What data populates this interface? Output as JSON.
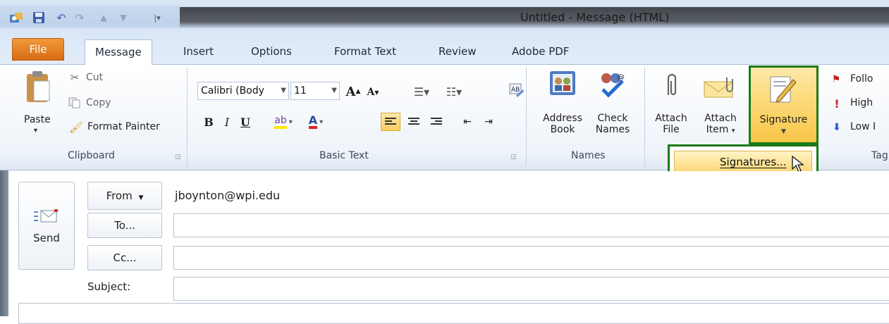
{
  "window": {
    "title": "Untitled  -  Message (HTML)"
  },
  "quick_access": [
    {
      "name": "outlook-app-icon"
    },
    {
      "name": "save-icon"
    },
    {
      "name": "undo-icon"
    },
    {
      "name": "redo-icon"
    },
    {
      "name": "up-arrow-icon"
    },
    {
      "name": "down-arrow-icon"
    },
    {
      "name": "customize-toolbar-icon"
    }
  ],
  "tabs": [
    {
      "label": "File"
    },
    {
      "label": "Message"
    },
    {
      "label": "Insert"
    },
    {
      "label": "Options"
    },
    {
      "label": "Format Text"
    },
    {
      "label": "Review"
    },
    {
      "label": "Adobe PDF"
    }
  ],
  "clipboard": {
    "label": "Clipboard",
    "paste": "Paste",
    "cut": "Cut",
    "copy": "Copy",
    "format_painter": "Format Painter"
  },
  "basic_text": {
    "label": "Basic Text",
    "font_name": "Calibri (Body",
    "font_size": "11",
    "bold": "B",
    "italic": "I",
    "underline": "U",
    "font_color": "A"
  },
  "names": {
    "label": "Names",
    "address_book_1": "Address",
    "address_book_2": "Book",
    "check_names_1": "Check",
    "check_names_2": "Names"
  },
  "include": {
    "attach_file_1": "Attach",
    "attach_file_2": "File",
    "attach_item_1": "Attach",
    "attach_item_2": "Item",
    "signature": "Signature",
    "signatures_menu_item": "Signatures..."
  },
  "tags": {
    "label": "Tag",
    "follow_up": "Follo",
    "high_importance": "High",
    "low_importance": "Low I"
  },
  "message": {
    "send": "Send",
    "from_button": "From",
    "from_value": "jboynton@wpi.edu",
    "to_button": "To...",
    "cc_button": "Cc...",
    "subject_label": "Subject:"
  },
  "colors": {
    "file_tab": "#d86a14",
    "highlight_border": "#1b7a18",
    "signature_fill": "#fbd56b"
  }
}
